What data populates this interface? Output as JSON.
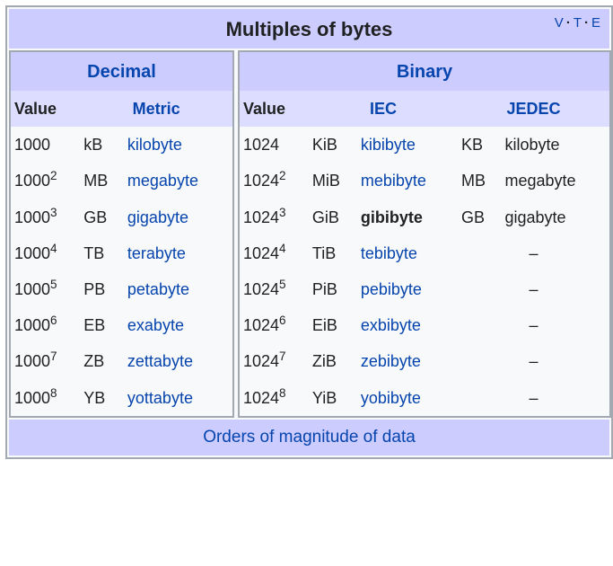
{
  "title": "Multiples of bytes",
  "vte": {
    "v": "V",
    "t": "T",
    "e": "E"
  },
  "decimal": {
    "header": "Decimal",
    "cols": {
      "value": "Value",
      "metric": "Metric"
    },
    "base": "1000",
    "rows": [
      {
        "exp": "",
        "sym": "kB",
        "name": "kilobyte"
      },
      {
        "exp": "2",
        "sym": "MB",
        "name": "megabyte"
      },
      {
        "exp": "3",
        "sym": "GB",
        "name": "gigabyte"
      },
      {
        "exp": "4",
        "sym": "TB",
        "name": "terabyte"
      },
      {
        "exp": "5",
        "sym": "PB",
        "name": "petabyte"
      },
      {
        "exp": "6",
        "sym": "EB",
        "name": "exabyte"
      },
      {
        "exp": "7",
        "sym": "ZB",
        "name": "zettabyte"
      },
      {
        "exp": "8",
        "sym": "YB",
        "name": "yottabyte"
      }
    ]
  },
  "binary": {
    "header": "Binary",
    "cols": {
      "value": "Value",
      "iec": "IEC",
      "jedec": "JEDEC"
    },
    "base": "1024",
    "rows": [
      {
        "exp": "",
        "iec_sym": "KiB",
        "iec_name": "kibibyte",
        "iec_bold": false,
        "jedec_sym": "KB",
        "jedec_name": "kilobyte"
      },
      {
        "exp": "2",
        "iec_sym": "MiB",
        "iec_name": "mebibyte",
        "iec_bold": false,
        "jedec_sym": "MB",
        "jedec_name": "megabyte"
      },
      {
        "exp": "3",
        "iec_sym": "GiB",
        "iec_name": "gibibyte",
        "iec_bold": true,
        "jedec_sym": "GB",
        "jedec_name": "gigabyte"
      },
      {
        "exp": "4",
        "iec_sym": "TiB",
        "iec_name": "tebibyte",
        "iec_bold": false,
        "jedec_sym": "",
        "jedec_name": "–"
      },
      {
        "exp": "5",
        "iec_sym": "PiB",
        "iec_name": "pebibyte",
        "iec_bold": false,
        "jedec_sym": "",
        "jedec_name": "–"
      },
      {
        "exp": "6",
        "iec_sym": "EiB",
        "iec_name": "exbibyte",
        "iec_bold": false,
        "jedec_sym": "",
        "jedec_name": "–"
      },
      {
        "exp": "7",
        "iec_sym": "ZiB",
        "iec_name": "zebibyte",
        "iec_bold": false,
        "jedec_sym": "",
        "jedec_name": "–"
      },
      {
        "exp": "8",
        "iec_sym": "YiB",
        "iec_name": "yobibyte",
        "iec_bold": false,
        "jedec_sym": "",
        "jedec_name": "–"
      }
    ]
  },
  "footer": "Orders of magnitude of data"
}
